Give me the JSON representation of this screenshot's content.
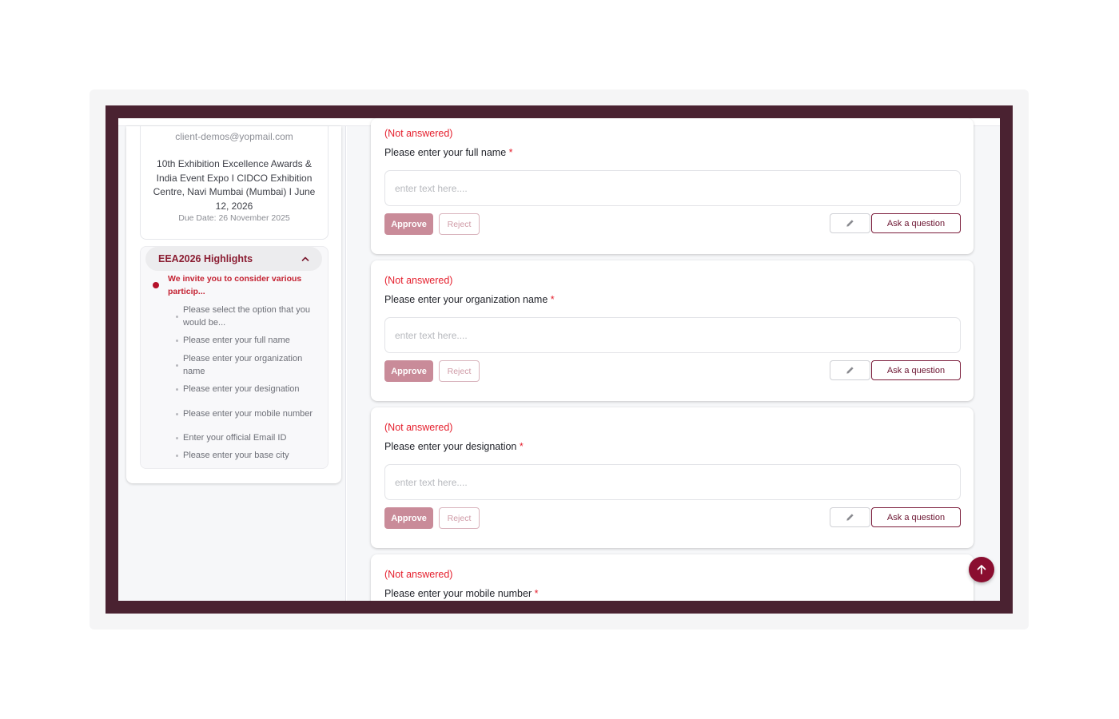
{
  "sidebar": {
    "email": "client-demos@yopmail.com",
    "event_title": "10th Exhibition Excellence Awards & India Event Expo I CIDCO Exhibition Centre, Navi Mumbai (Mumbai) I June 12, 2026",
    "due_date": "Due Date: 26 November 2025",
    "highlights": {
      "title": "EEA2026 Highlights",
      "main_item": "We invite you to consider various particip...",
      "items": [
        "Please select the option that you would be...",
        "Please enter your full name",
        "Please enter your organization name",
        "Please enter your designation",
        "Please enter your mobile number",
        "Enter your official Email ID",
        "Please enter your base city"
      ]
    }
  },
  "questions": [
    {
      "status": "(Not answered)",
      "label": "Please enter your full name",
      "required_mark": "*",
      "placeholder": "enter text here....",
      "approve_label": "Approve",
      "reject_label": "Reject",
      "edit_icon": "pencil-icon",
      "ask_label": "Ask a question"
    },
    {
      "status": "(Not answered)",
      "label": "Please enter your organization name",
      "required_mark": "*",
      "placeholder": "enter text here....",
      "approve_label": "Approve",
      "reject_label": "Reject",
      "edit_icon": "pencil-icon",
      "ask_label": "Ask a question"
    },
    {
      "status": "(Not answered)",
      "label": "Please enter your designation",
      "required_mark": "*",
      "placeholder": "enter text here....",
      "approve_label": "Approve",
      "reject_label": "Reject",
      "edit_icon": "pencil-icon",
      "ask_label": "Ask a question"
    },
    {
      "status": "(Not answered)",
      "label": "Please enter your mobile number",
      "required_mark": "*"
    }
  ],
  "icons": {
    "collapse": "chevron-up-icon",
    "scroll_top": "arrow-up-icon"
  },
  "colors": {
    "frame": "#4a2231",
    "brand": "#8a0e30",
    "status_red": "#e5202e",
    "approve_bg": "#c98b99"
  }
}
